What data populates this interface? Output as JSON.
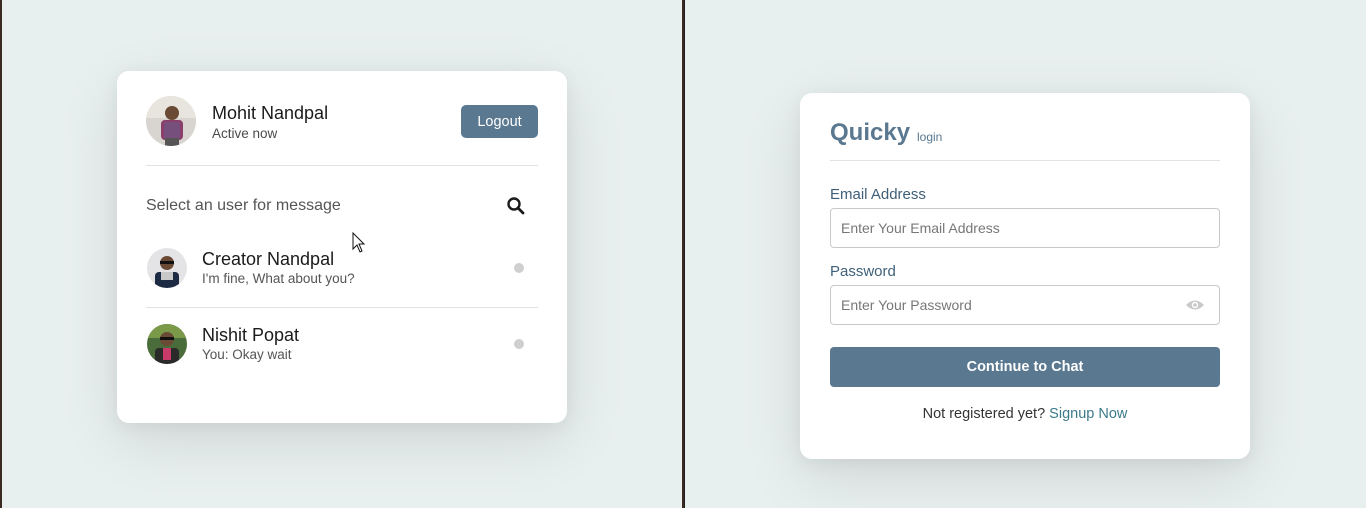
{
  "chat": {
    "me": {
      "name": "Mohit Nandpal",
      "status": "Active now"
    },
    "logout_label": "Logout",
    "search_hint": "Select an user for message",
    "users": [
      {
        "name": "Creator Nandpal",
        "last_message": "I'm fine, What about you?"
      },
      {
        "name": "Nishit Popat",
        "last_message": "You: Okay wait"
      }
    ]
  },
  "login": {
    "brand": "Quicky",
    "brand_sub": "login",
    "email_label": "Email Address",
    "email_placeholder": "Enter Your Email Address",
    "password_label": "Password",
    "password_placeholder": "Enter Your Password",
    "submit_label": "Continue to Chat",
    "footer_text": "Not registered yet?",
    "signup_link": "Signup Now"
  },
  "colors": {
    "accent": "#5a7890",
    "background": "#e8efef",
    "link": "#3b7a8a",
    "status_dot": "#cfcfcf"
  }
}
